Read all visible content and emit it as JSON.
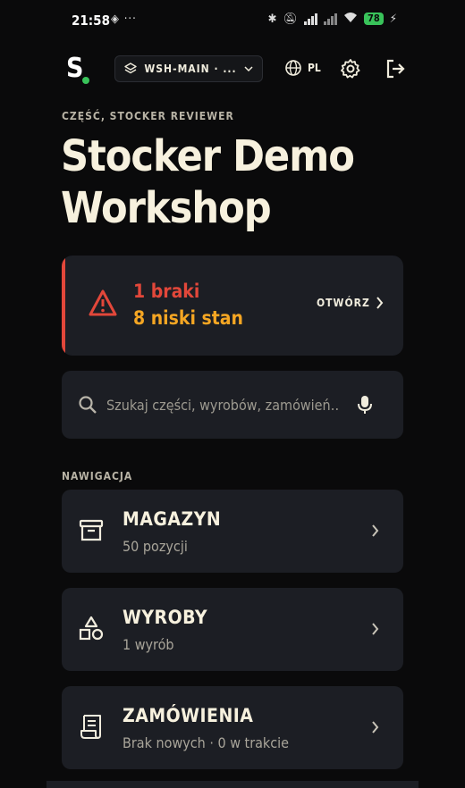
{
  "status_bar": {
    "time": "21:58",
    "left_icons": "◈ ···",
    "battery": "78"
  },
  "header": {
    "logo": "S",
    "workspace": "WSH-MAIN · ...",
    "language": "PL"
  },
  "breadcrumb": "CZĘŚĆ, STOCKER REVIEWER",
  "page_title": "Stocker Demo Workshop",
  "alert": {
    "shortages": "1 braki",
    "low_stock": "8 niski stan",
    "open_label": "OTWÓRZ"
  },
  "search": {
    "placeholder": "Szukaj części, wyrobów, zamówień…"
  },
  "nav": {
    "label": "NAWIGACJA",
    "items": [
      {
        "title": "MAGAZYN",
        "subtitle": "50 pozycji",
        "icon": "archive-box-icon"
      },
      {
        "title": "WYROBY",
        "subtitle": "1 wyrób",
        "icon": "shapes-icon"
      },
      {
        "title": "ZAMÓWIENIA",
        "subtitle": "Brak nowych · 0 w trakcie",
        "icon": "receipt-icon"
      }
    ]
  },
  "colors": {
    "accent_green": "#39c35a",
    "danger": "#e2473a",
    "warning": "#f5a623",
    "card": "#1c1e24",
    "background": "#0a0a0b"
  }
}
